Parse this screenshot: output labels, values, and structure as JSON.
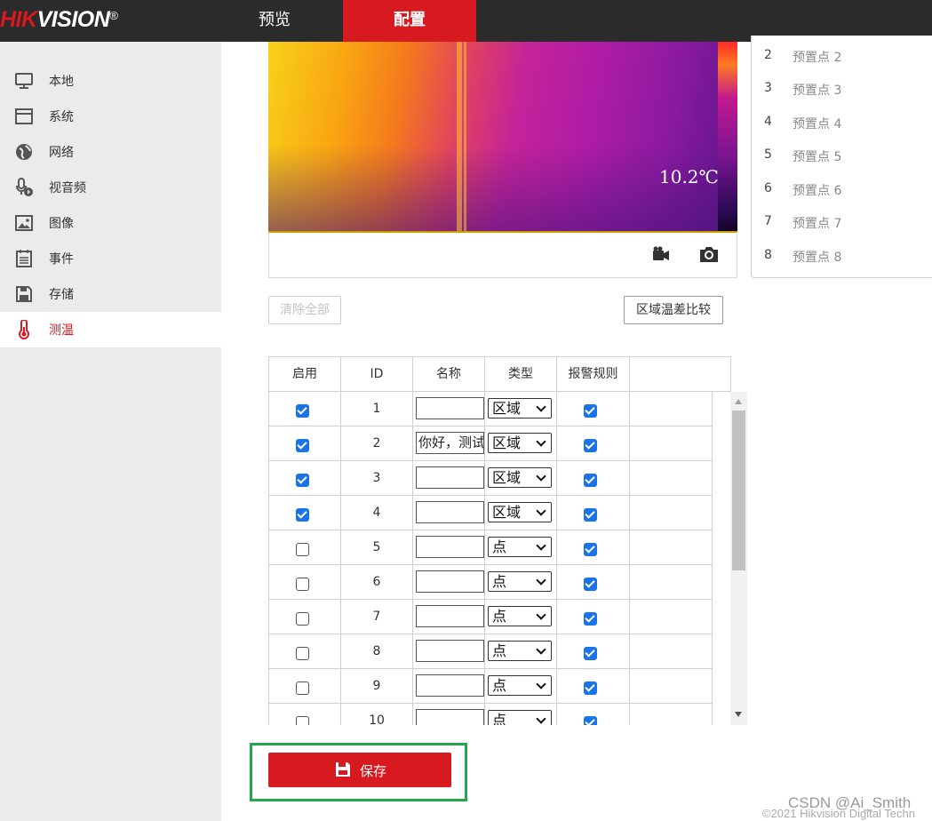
{
  "header": {
    "logo_brand": "HIK",
    "logo_rest": "VISION",
    "logo_mark": "®",
    "nav": {
      "preview": "预览",
      "config": "配置"
    },
    "active_nav": "config"
  },
  "sidebar": {
    "items": [
      {
        "label": "本地",
        "icon": "monitor-icon"
      },
      {
        "label": "系统",
        "icon": "window-icon"
      },
      {
        "label": "网络",
        "icon": "globe-icon"
      },
      {
        "label": "视音频",
        "icon": "microphone-video-icon"
      },
      {
        "label": "图像",
        "icon": "image-icon"
      },
      {
        "label": "事件",
        "icon": "calendar-list-icon"
      },
      {
        "label": "存储",
        "icon": "floppy-disk-icon"
      },
      {
        "label": "测温",
        "icon": "thermometer-icon"
      }
    ],
    "active_index": 7
  },
  "preview": {
    "temperature": "10.2℃",
    "record_icon": "video-record-icon",
    "snapshot_icon": "camera-icon"
  },
  "presets": [
    {
      "num": "2",
      "name": "预置点 2"
    },
    {
      "num": "3",
      "name": "预置点 3"
    },
    {
      "num": "4",
      "name": "预置点 4"
    },
    {
      "num": "5",
      "name": "预置点 5"
    },
    {
      "num": "6",
      "name": "预置点 6"
    },
    {
      "num": "7",
      "name": "预置点 7"
    },
    {
      "num": "8",
      "name": "预置点 8"
    }
  ],
  "buttons": {
    "clear_all": "清除全部",
    "region_diff": "区域温差比较",
    "save": "保存"
  },
  "table": {
    "headers": [
      "启用",
      "ID",
      "名称",
      "类型",
      "报警规则",
      ""
    ],
    "rows": [
      {
        "enabled": true,
        "id": "1",
        "name": "",
        "type": "区域",
        "alarm": true
      },
      {
        "enabled": true,
        "id": "2",
        "name": "你好，测试",
        "type": "区域",
        "alarm": true
      },
      {
        "enabled": true,
        "id": "3",
        "name": "",
        "type": "区域",
        "alarm": true
      },
      {
        "enabled": true,
        "id": "4",
        "name": "",
        "type": "区域",
        "alarm": true
      },
      {
        "enabled": false,
        "id": "5",
        "name": "",
        "type": "点",
        "alarm": true
      },
      {
        "enabled": false,
        "id": "6",
        "name": "",
        "type": "点",
        "alarm": true
      },
      {
        "enabled": false,
        "id": "7",
        "name": "",
        "type": "点",
        "alarm": true
      },
      {
        "enabled": false,
        "id": "8",
        "name": "",
        "type": "点",
        "alarm": true
      },
      {
        "enabled": false,
        "id": "9",
        "name": "",
        "type": "点",
        "alarm": true
      },
      {
        "enabled": false,
        "id": "10",
        "name": "",
        "type": "点",
        "alarm": true
      }
    ]
  },
  "watermark": "CSDN @Ai_Smith",
  "footer": "©2021 Hikvision Digital Techn",
  "colors": {
    "brand_red": "#d71920",
    "topbar": "#2b2b2b",
    "sidebar_bg": "#ebebeb",
    "checkbox_blue": "#1a73e8",
    "highlight_green": "#22a84a"
  }
}
